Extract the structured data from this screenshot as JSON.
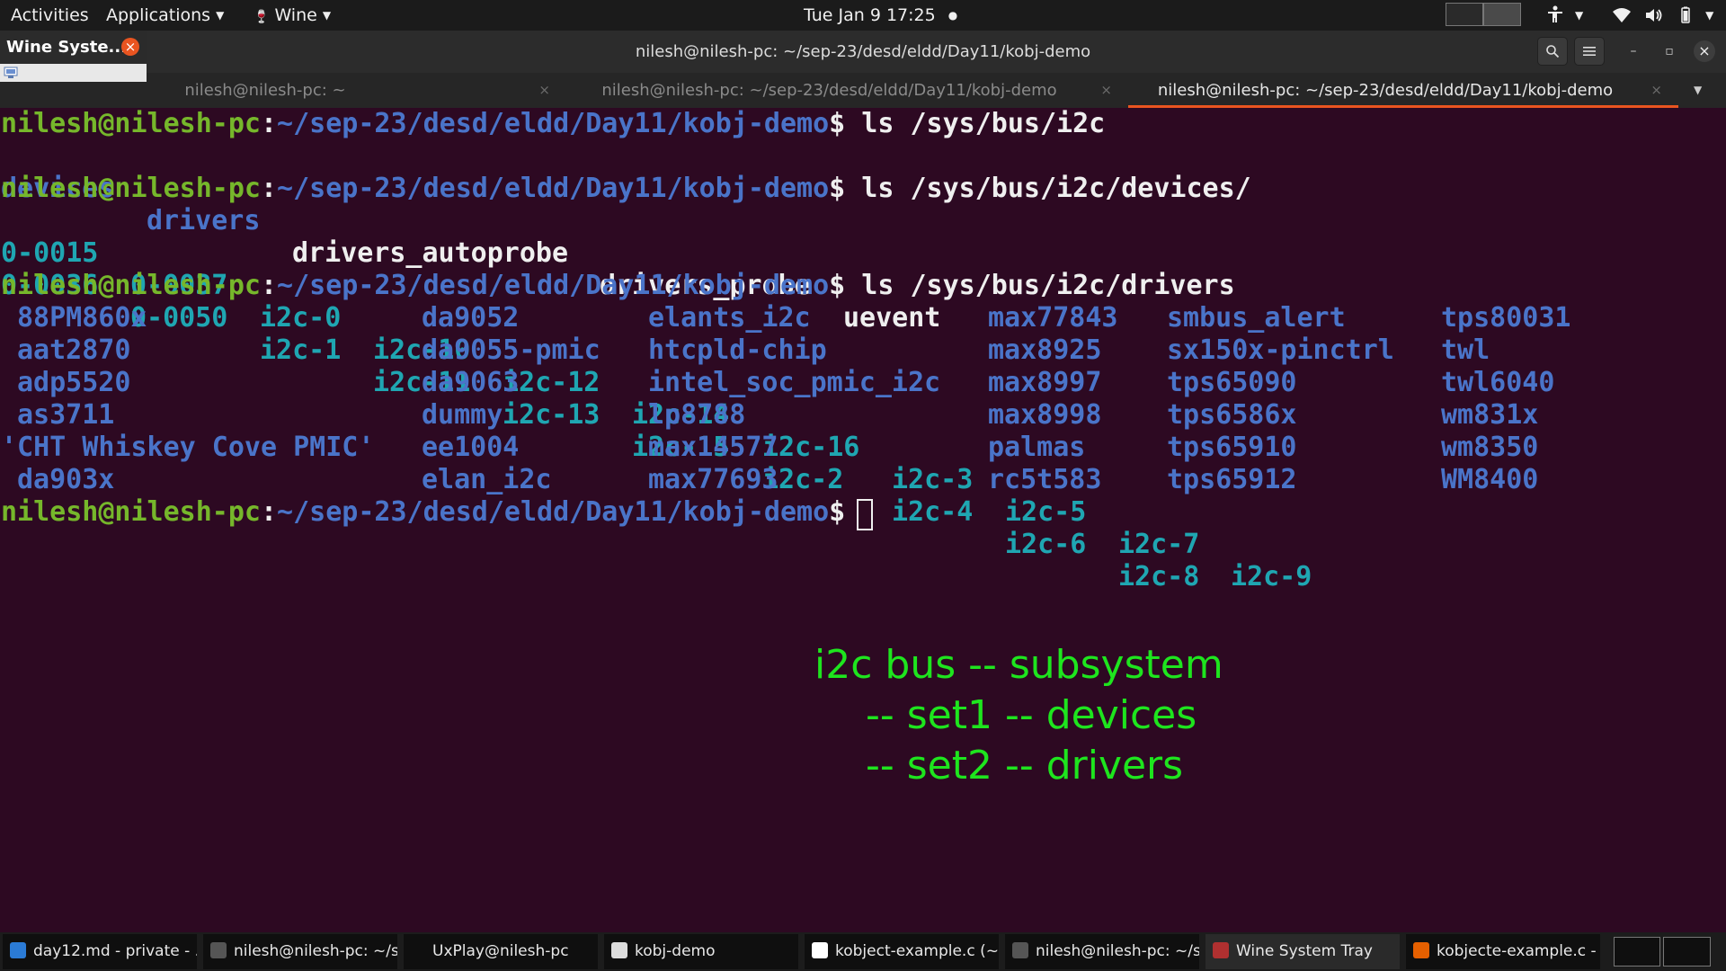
{
  "topbar": {
    "activities": "Activities",
    "applications": "Applications",
    "wine": "Wine",
    "datetime": "Tue Jan 9  17:25",
    "dot": "●"
  },
  "wine_popup": {
    "title": "Wine Syste...",
    "close": "×"
  },
  "window": {
    "title": "nilesh@nilesh-pc: ~/sep-23/desd/eldd/Day11/kobj-demo",
    "minimize": "–",
    "maximize": "▫",
    "close": "×"
  },
  "tabs": [
    {
      "label": "nilesh@nilesh-pc: ~",
      "close": "×"
    },
    {
      "label": "nilesh@nilesh-pc: ~/sep-23/desd/eldd/Day11/kobj-demo",
      "close": "×"
    },
    {
      "label": "nilesh@nilesh-pc: ~/sep-23/desd/eldd/Day11/kobj-demo",
      "close": "×"
    }
  ],
  "terminal": {
    "prompt_user": "nilesh@nilesh-pc",
    "prompt_sep": ":",
    "prompt_path": "~/sep-23/desd/eldd/Day11/kobj-demo",
    "prompt_end": "$ ",
    "commands": [
      "ls /sys/bus/i2c",
      "ls /sys/bus/i2c/devices/",
      "ls /sys/bus/i2c/drivers"
    ],
    "bus_entries": {
      "dirs": [
        "devices",
        "drivers"
      ],
      "files": [
        "drivers_autoprobe",
        "drivers_probe",
        "uevent"
      ]
    },
    "devices_row1": [
      "0-0015",
      "0-0037",
      "i2c-0",
      "i2c-10",
      "i2c-12",
      "i2c-14",
      "i2c-16",
      "i2c-3",
      "i2c-5",
      "i2c-7",
      "i2c-9"
    ],
    "devices_row2": [
      "0-0036",
      "0-0050",
      "i2c-1",
      "i2c-11",
      "i2c-13",
      "i2c-15",
      "i2c-2",
      "i2c-4",
      "i2c-6",
      "i2c-8"
    ],
    "drivers": [
      [
        "88PM860x",
        "da9052",
        "elants_i2c",
        "max77843",
        "smbus_alert",
        "tps80031"
      ],
      [
        "aat2870",
        "da9055-pmic",
        "htcpld-chip",
        "max8925",
        "sx150x-pinctrl",
        "twl"
      ],
      [
        "adp5520",
        "da9063",
        "intel_soc_pmic_i2c",
        "max8997",
        "tps65090",
        "twl6040"
      ],
      [
        "as3711",
        "dummy",
        "lp8788",
        "max8998",
        "tps6586x",
        "wm831x"
      ],
      [
        "'CHT Whiskey Cove PMIC'",
        "ee1004",
        "max14577",
        "palmas",
        "tps65910",
        "wm8350"
      ],
      [
        "da903x",
        "elan_i2c",
        "max77693",
        "rc5t583",
        "tps65912",
        "WM8400"
      ]
    ]
  },
  "notes": [
    "i2c bus -- subsystem",
    "-- set1 -- devices",
    "-- set2 -- drivers"
  ],
  "taskbar": [
    {
      "label": "day12.md - private - ...",
      "icon": "vscode-icon",
      "color": "#2b7bd6"
    },
    {
      "label": "nilesh@nilesh-pc: ~/s...",
      "icon": "terminal-icon",
      "color": "#555555"
    },
    {
      "label": "UxPlay@nilesh-pc",
      "icon": "",
      "color": ""
    },
    {
      "label": "kobj-demo",
      "icon": "folder-icon",
      "color": "#dcdcdc"
    },
    {
      "label": "kobject-example.c (~/...",
      "icon": "text-editor-icon",
      "color": "#ffffff"
    },
    {
      "label": "nilesh@nilesh-pc: ~/s...",
      "icon": "terminal-icon",
      "color": "#555555"
    },
    {
      "label": "Wine System Tray",
      "icon": "wine-icon",
      "color": "#b03030"
    },
    {
      "label": "kobjecte-example.c - s...",
      "icon": "firefox-icon",
      "color": "#e66000"
    }
  ]
}
